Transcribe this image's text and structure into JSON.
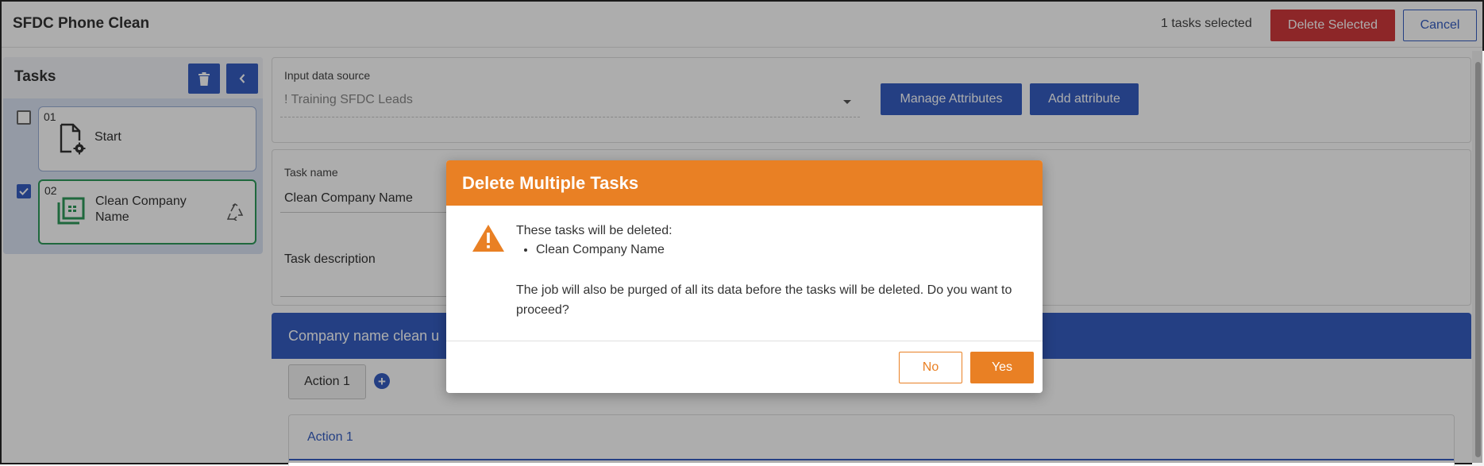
{
  "header": {
    "title": "SFDC Phone Clean",
    "selected_count": "1 tasks selected",
    "delete_selected_label": "Delete Selected",
    "cancel_label": "Cancel"
  },
  "tasks_panel": {
    "title": "Tasks",
    "items": [
      {
        "number": "01",
        "label": "Start",
        "checked": false
      },
      {
        "number": "02",
        "label": "Clean Company Name",
        "checked": true
      }
    ]
  },
  "source": {
    "label": "Input data source",
    "value": "! Training SFDC Leads",
    "manage_attributes_label": "Manage Attributes",
    "add_attribute_label": "Add attribute"
  },
  "task_form": {
    "name_label": "Task name",
    "name_value": "Clean Company Name",
    "description_label": "Task description"
  },
  "section": {
    "title": "Company name clean u"
  },
  "actions": {
    "tab_label": "Action 1",
    "add_icon": "plus-circle-icon",
    "panel_title": "Action 1"
  },
  "dialog": {
    "title": "Delete Multiple Tasks",
    "line1": "These tasks will be deleted:",
    "items": [
      "Clean Company Name"
    ],
    "message": "The job will also be purged of all its data before the tasks will be deleted. Do you want to proceed?",
    "no_label": "No",
    "yes_label": "Yes"
  },
  "colors": {
    "primary": "#355ec2",
    "danger": "#d0393c",
    "warning": "#e98024",
    "active_task_border": "#2e9a5a"
  }
}
